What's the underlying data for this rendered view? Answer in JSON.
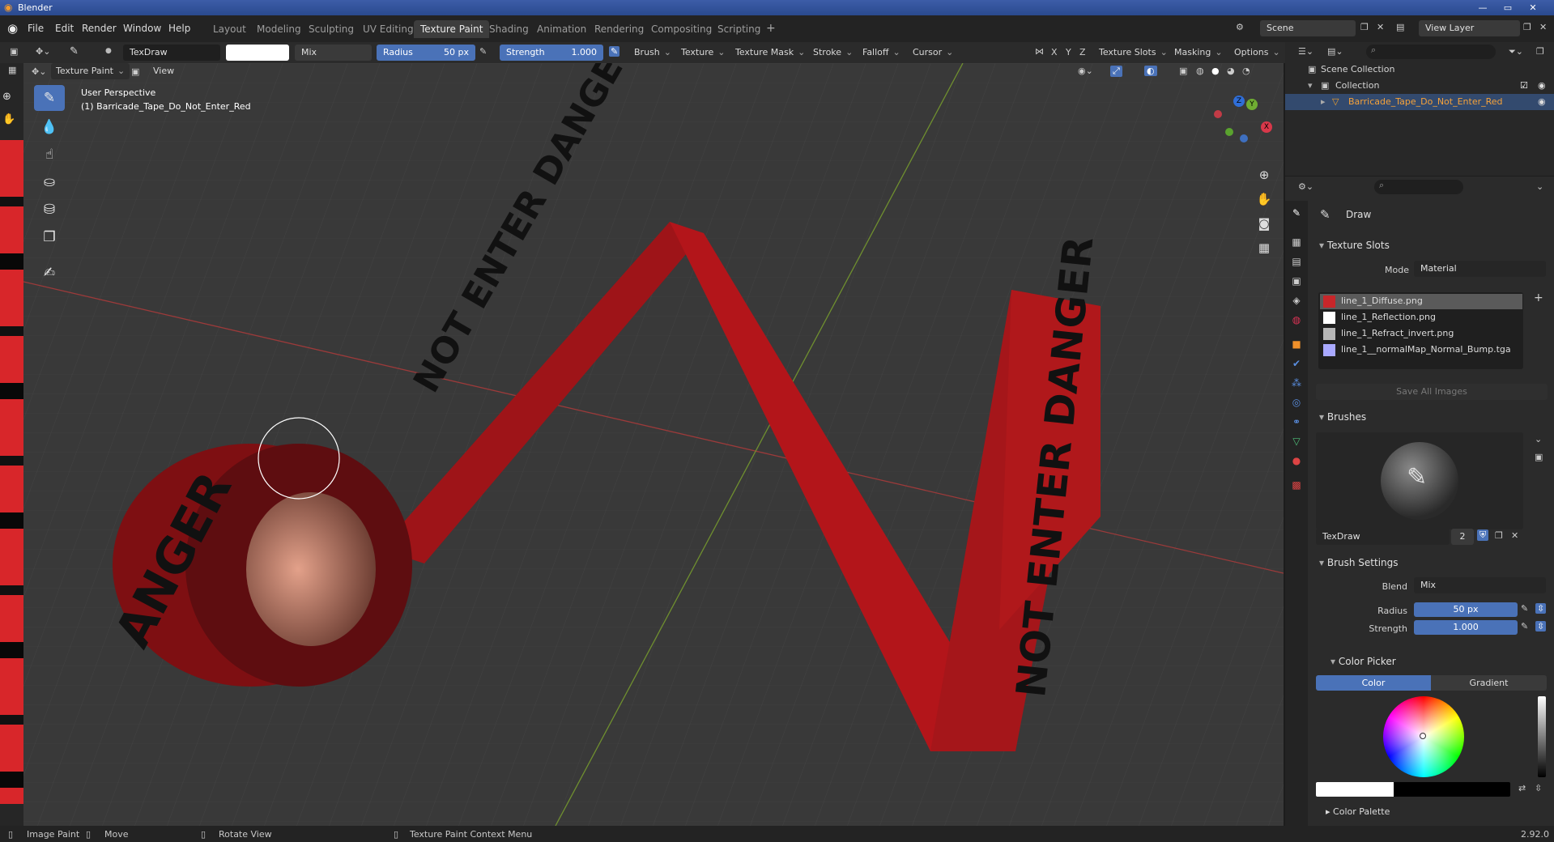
{
  "window": {
    "title": "Blender",
    "min": "—",
    "max": "▭",
    "close": "✕"
  },
  "menus": [
    "File",
    "Edit",
    "Render",
    "Window",
    "Help"
  ],
  "workspaces": [
    {
      "label": "Layout"
    },
    {
      "label": "Modeling"
    },
    {
      "label": "Sculpting"
    },
    {
      "label": "UV Editing"
    },
    {
      "label": "Texture Paint",
      "active": true
    },
    {
      "label": "Shading"
    },
    {
      "label": "Animation"
    },
    {
      "label": "Rendering"
    },
    {
      "label": "Compositing"
    },
    {
      "label": "Scripting"
    }
  ],
  "add_workspace": "+",
  "scene": {
    "label": "Scene"
  },
  "view_layer": {
    "label": "View Layer"
  },
  "tool_header": {
    "brush_name": "TexDraw",
    "blend": "Mix",
    "radius_label": "Radius",
    "radius_value": "50 px",
    "strength_label": "Strength",
    "strength_value": "1.000",
    "menus": [
      "Brush",
      "Texture",
      "Texture Mask",
      "Stroke",
      "Falloff",
      "Cursor"
    ],
    "axes": [
      "X",
      "Y",
      "Z"
    ],
    "right_menus": [
      "Texture Slots",
      "Masking",
      "Options"
    ]
  },
  "viewport_header": {
    "mode": "Texture Paint",
    "view": "View"
  },
  "viewport": {
    "perspective": "User Perspective",
    "object_label": "(1) Barricade_Tape_Do_Not_Enter_Red",
    "gizmo": {
      "x": "X",
      "y": "Y",
      "z": "Z"
    },
    "tape_text_1": "NOT ENTER DANGER",
    "tape_text_2": "NOT ENTER DANGER",
    "roll_text": "ANGER"
  },
  "outliner": {
    "scene_collection": "Scene Collection",
    "collection": "Collection",
    "object": "Barricade_Tape_Do_Not_Enter_Red"
  },
  "properties": {
    "tool_name": "Draw",
    "texture_slots": {
      "header": "Texture Slots",
      "mode_label": "Mode",
      "mode_value": "Material",
      "slots": [
        {
          "name": "line_1_Diffuse.png",
          "color": "#c8262a",
          "selected": true
        },
        {
          "name": "line_1_Reflection.png",
          "color": "#ffffff"
        },
        {
          "name": "line_1_Refract_invert.png",
          "color": "#b5b5b5"
        },
        {
          "name": "line_1__normalMap_Normal_Bump.tga",
          "color": "#a9a9ff"
        }
      ],
      "save_all": "Save All Images"
    },
    "brushes": {
      "header": "Brushes",
      "brush_name": "TexDraw",
      "users": "2"
    },
    "brush_settings": {
      "header": "Brush Settings",
      "blend_label": "Blend",
      "blend_value": "Mix",
      "radius_label": "Radius",
      "radius_value": "50 px",
      "strength_label": "Strength",
      "strength_value": "1.000"
    },
    "color_picker": {
      "header": "Color Picker",
      "tab_color": "Color",
      "tab_gradient": "Gradient"
    },
    "color_palette": {
      "header": "Color Palette"
    }
  },
  "status": {
    "image_paint": "Image Paint",
    "move": "Move",
    "rotate": "Rotate View",
    "context": "Texture Paint Context Menu",
    "version": "2.92.0"
  },
  "colors": {
    "accent": "#4a72b8",
    "tape": "#b3151a",
    "grid": "#3c3c3c"
  }
}
